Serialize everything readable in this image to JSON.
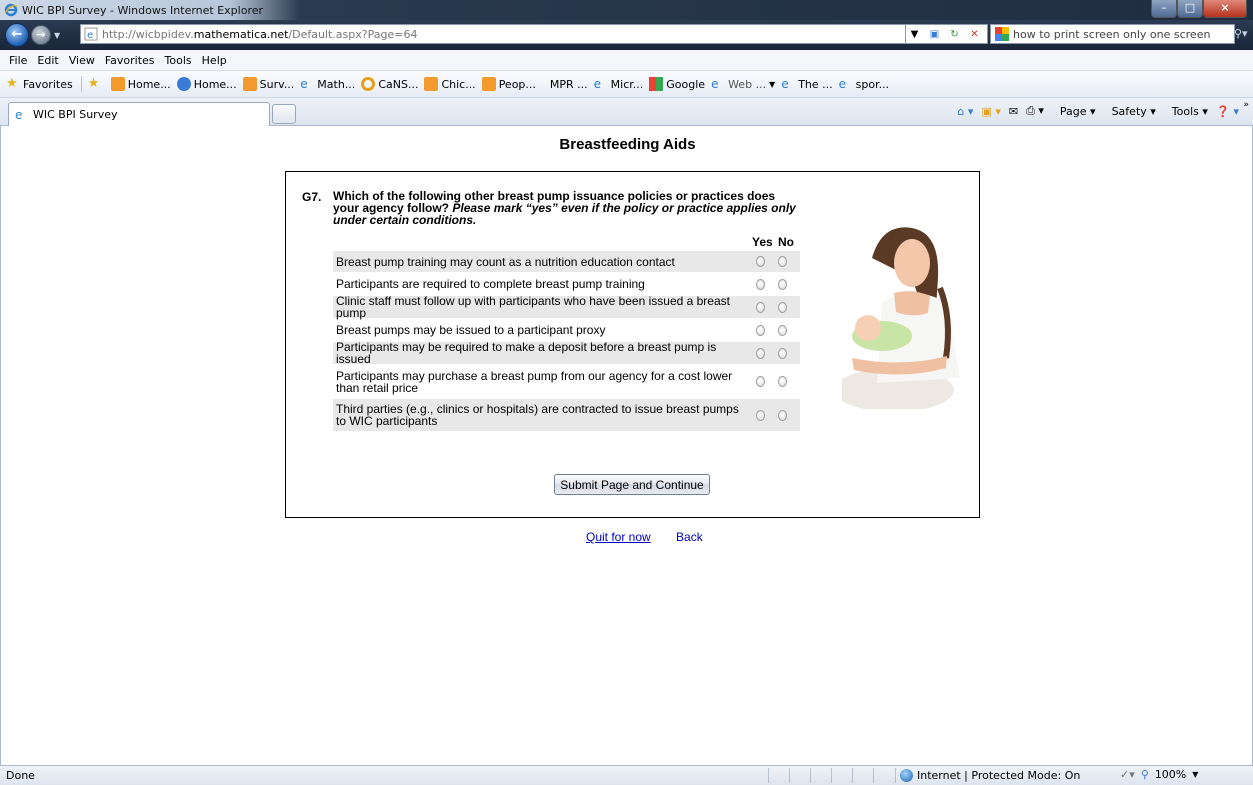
{
  "window": {
    "title": "WIC BPI Survey - Windows Internet Explorer"
  },
  "address": {
    "url_prefix": "http://wicbpidev.",
    "url_domain": "mathematica.net",
    "url_suffix": "/Default.aspx?Page=64",
    "search_query": "how to print screen only one screen"
  },
  "menu": [
    "File",
    "Edit",
    "View",
    "Favorites",
    "Tools",
    "Help"
  ],
  "favorites": {
    "label": "Favorites",
    "items": [
      "Home...",
      "Home...",
      "Surv...",
      "Math...",
      "CaNS...",
      "Chic...",
      "Peop...",
      "MPR ...",
      "Micr...",
      "Google",
      "Web ...",
      "The ...",
      "spor..."
    ]
  },
  "tab": {
    "title": "WIC BPI Survey"
  },
  "commands": {
    "page": "Page",
    "safety": "Safety",
    "tools": "Tools"
  },
  "page": {
    "heading": "Breastfeeding Aids",
    "question_number": "G7.",
    "question_text": "Which of the following other breast pump issuance policies or practices does your agency follow?",
    "question_note": "Please mark “yes” even if the policy or practice applies only under certain conditions.",
    "col_yes": "Yes",
    "col_no": "No",
    "rows": [
      "Breast pump training may count as a nutrition education contact",
      "Participants are required to complete breast pump training",
      "Clinic staff must follow up with participants who have been issued a breast pump",
      "Breast pumps may be issued to a participant proxy",
      "Participants may be required to make a deposit before a breast pump is issued",
      "Participants may purchase a breast pump from our agency for a cost lower than retail price",
      "Third parties (e.g., clinics or hospitals) are contracted to issue breast pumps to WIC participants"
    ],
    "submit_label": "Submit Page and Continue",
    "quit_label": "Quit for now",
    "back_label": "Back"
  },
  "status": {
    "text": "Done",
    "zone": "Internet | Protected Mode: On",
    "zoom": "100%"
  }
}
